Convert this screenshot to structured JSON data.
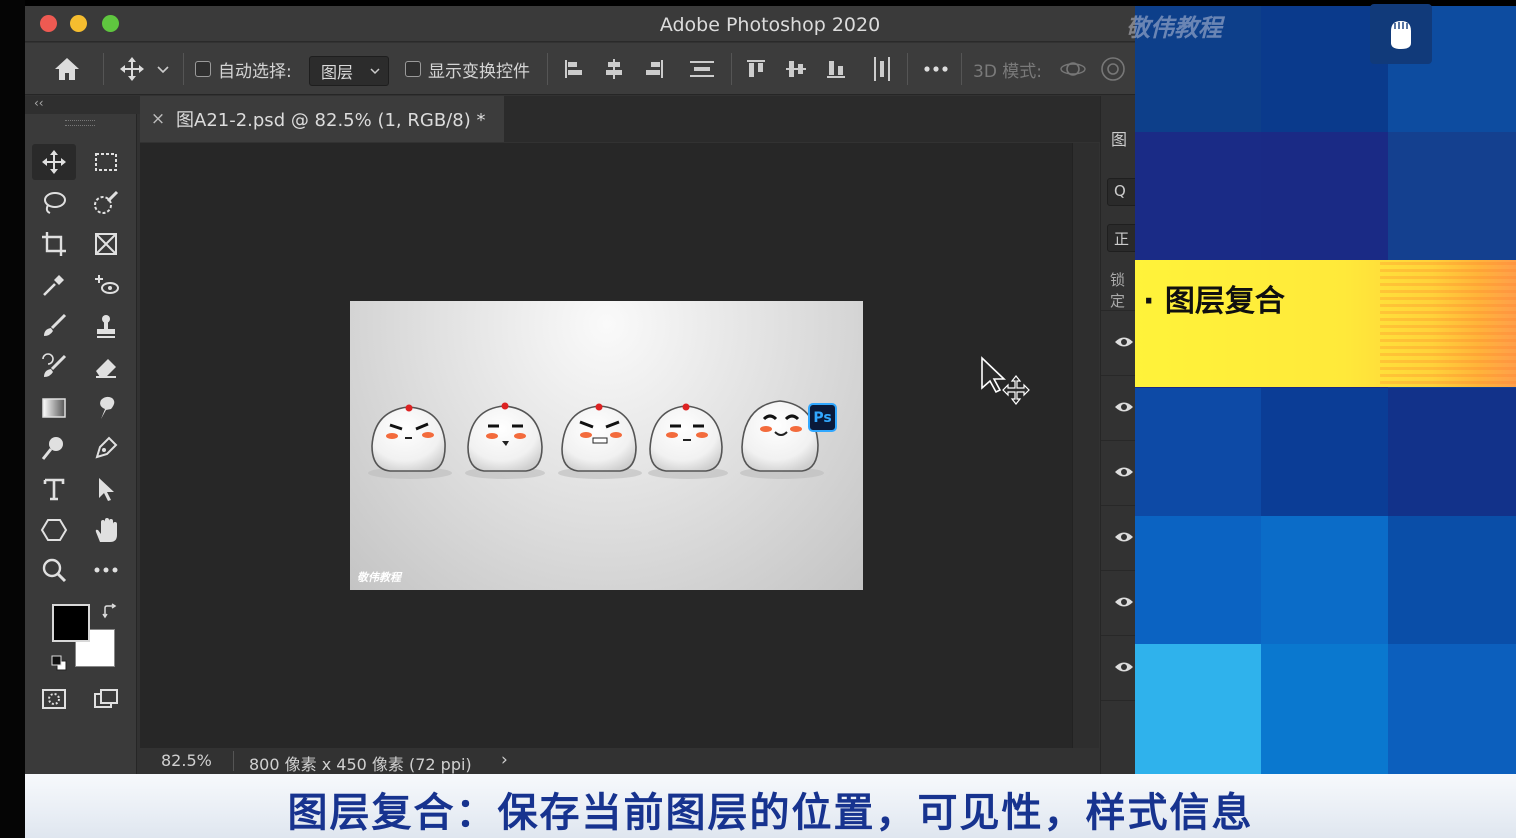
{
  "window": {
    "title": "Adobe Photoshop 2020"
  },
  "options_bar": {
    "auto_select_label": "自动选择:",
    "auto_select_target": "图层",
    "show_transform_label": "显示变换控件",
    "mode_3d_label": "3D 模式:"
  },
  "panel": {
    "collapse_label": "‹‹"
  },
  "document": {
    "tab_title": "图A21-2.psd @ 82.5% (1, RGB/8) *",
    "close_glyph": "×",
    "watermark": "敬伟教程",
    "ps_badge": "Ps"
  },
  "status": {
    "zoom": "82.5%",
    "doc_info": "800 像素 x 450 像素 (72 ppi)",
    "arrow": "›"
  },
  "right_panel": {
    "tab_label": "图",
    "search_glyph": "Q",
    "blend_label": "正",
    "lock_label": "锁定"
  },
  "overlay": {
    "brand_watermark": "敬伟教程",
    "banner_text": "· 图层复合",
    "subtitle": "图层复合：保存当前图层的位置，可见性，样式信息"
  },
  "colors": {
    "accent_blue": "#31a8ff",
    "banner_yellow": "#ffe93a",
    "subtitle_blue": "#17338f"
  },
  "icons": [
    "home-icon",
    "move-icon",
    "align-icons",
    "more-icon",
    "3d-orbit-icon",
    "marquee-icon",
    "lasso-icon",
    "quick-select-icon",
    "crop-icon",
    "frame-icon",
    "eyedropper-icon",
    "healing-icon",
    "brush-icon",
    "stamp-icon",
    "history-brush-icon",
    "eraser-icon",
    "gradient-icon",
    "smudge-icon",
    "dodge-icon",
    "pen-icon",
    "type-icon",
    "path-select-icon",
    "shape-icon",
    "hand-icon",
    "zoom-icon",
    "edit-toolbar-icon",
    "quick-mask-icon",
    "screen-mode-icon",
    "eye-icon",
    "cursor-icon"
  ]
}
